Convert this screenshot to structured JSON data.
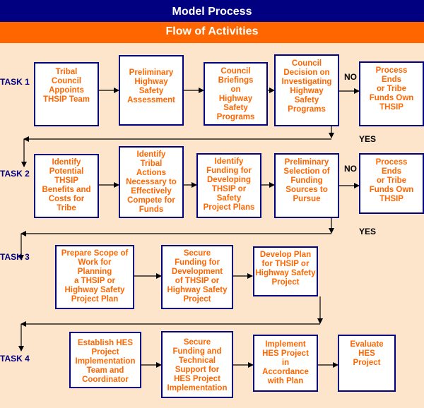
{
  "header": {
    "title": "Model Process",
    "subtitle": "Flow of Activities"
  },
  "tasks": [
    {
      "label": "TASK 1"
    },
    {
      "label": "TASK 2"
    },
    {
      "label": "TASK 3"
    },
    {
      "label": "TASK 4"
    }
  ],
  "decisions": {
    "no": "NO",
    "yes": "YES"
  },
  "boxes": {
    "t1": [
      "Tribal\nCouncil\nAppoints\nTHSIP Team",
      "Preliminary\nHighway\nSafety\nAssessment",
      "Council\nBriefings\non\nHighway\nSafety\nPrograms",
      "Council\nDecision on\nInvestigating\nHighway\nSafety\nPrograms",
      "Process\nEnds\nor Tribe\nFunds Own\nTHSIP"
    ],
    "t2": [
      "Identify\nPotential\nTHSIP\nBenefits and\nCosts for\nTribe",
      "Identify\nTribal\nActions\nNecessary to\nEffectively\nCompete for\nFunds",
      "Identify\nFunding for\nDeveloping\nTHSIP or\nSafety\nProject Plans",
      "Preliminary\nSelection of\nFunding\nSources to\nPursue",
      "Process\nEnds\nor Tribe\nFunds Own\nTHSIP"
    ],
    "t3": [
      "Prepare Scope of\nWork for\nPlanning\na THSIP or\nHighway Safety\nProject Plan",
      "Secure\nFunding for\nDevelopment\nof THSIP or\nHighway Safety\nProject",
      "Develop Plan\nfor THSIP or\nHighway Safety\nProject"
    ],
    "t4": [
      "Establish HES\nProject\nImplementation\nTeam and\nCoordinator",
      "Secure\nFunding and\nTechnical\nSupport for\nHES Project\nImplementation",
      "Implement\nHES Project\nin\nAccordance\nwith Plan",
      "Evaluate\nHES\nProject"
    ]
  }
}
